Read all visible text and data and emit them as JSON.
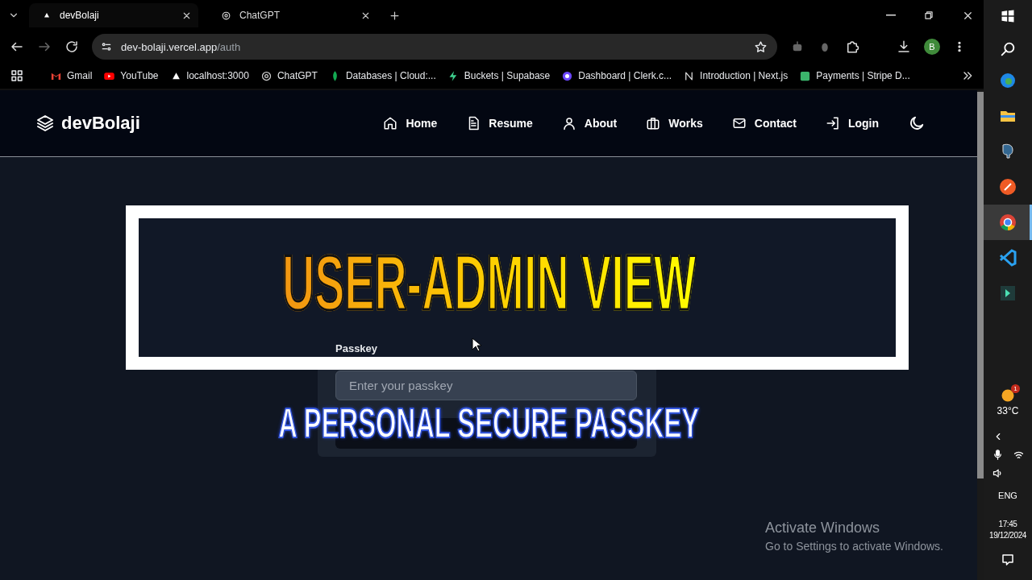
{
  "browser": {
    "tabs": [
      {
        "title": "devBolaji",
        "selected": true
      },
      {
        "title": "ChatGPT",
        "selected": false
      }
    ],
    "address": {
      "host": "dev-bolaji.vercel.app",
      "path": "/auth"
    },
    "profile": "B",
    "bookmarks": [
      "Gmail",
      "YouTube",
      "localhost:3000",
      "ChatGPT",
      "Databases | Cloud:...",
      "Buckets | Supabase",
      "Dashboard | Clerk.c...",
      "Introduction | Next.js",
      "Payments | Stripe D..."
    ]
  },
  "site": {
    "logo": "devBolaji",
    "nav": [
      "Home",
      "Resume",
      "About",
      "Works",
      "Contact",
      "Login"
    ]
  },
  "auth_form": {
    "label": "Passkey",
    "placeholder": "Enter your passkey"
  },
  "video_captions": {
    "title": "USER-ADMIN VIEW",
    "subtitle": "A PERSONAL SECURE PASSKEY"
  },
  "activation_notice": {
    "title": "Activate Windows",
    "message": "Go to Settings to activate Windows."
  },
  "taskbar": {
    "apps": [
      {
        "selected": false
      },
      {
        "selected": false
      },
      {
        "selected": false
      },
      {
        "selected": false
      },
      {
        "selected": true
      },
      {
        "selected": false
      },
      {
        "selected": false
      }
    ],
    "weather": {
      "temperature": "33°C",
      "badge": "1"
    },
    "language": "ENG",
    "time": "17:45",
    "date": "19/12/2024"
  }
}
